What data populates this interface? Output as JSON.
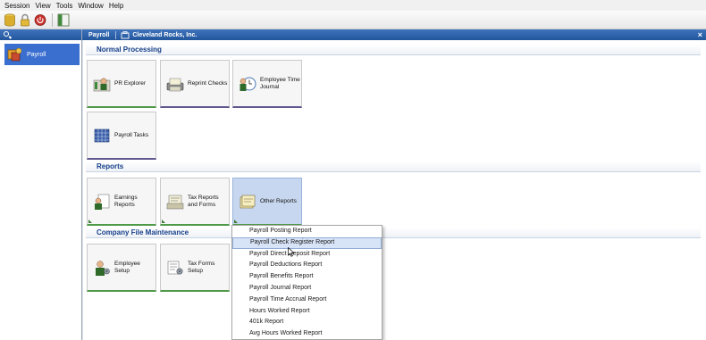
{
  "menu": [
    "Session",
    "View",
    "Tools",
    "Window",
    "Help"
  ],
  "toolbar": {
    "icons": [
      "database-icon",
      "lock-icon",
      "power-icon",
      "panel-icon"
    ]
  },
  "sidebar": {
    "items": [
      {
        "label": "Payroll",
        "icon": "payroll-icon",
        "selected": true
      }
    ]
  },
  "header": {
    "module": "Payroll",
    "company": "Cleveland Rocks, Inc."
  },
  "sections": {
    "normal": "Normal Processing",
    "reports": "Reports",
    "company_file": "Company File Maintenance"
  },
  "tiles": {
    "pr_explorer": "PR Explorer",
    "reprint_checks": "Reprint Checks",
    "employee_time_journal": "Employee Time Journal",
    "payroll_tasks": "Payroll Tasks",
    "earnings_reports": "Earnings Reports",
    "tax_reports_forms": "Tax Reports and Forms",
    "other_reports": "Other Reports",
    "employee_setup": "Employee Setup",
    "tax_forms_setup": "Tax Forms Setup"
  },
  "dropdown": {
    "items": [
      "Payroll Posting Report",
      "Payroll Check Register Report",
      "Payroll Direct Deposit Report",
      "Payroll Deductions Report",
      "Payroll Benefits Report",
      "Payroll Journal Report",
      "Payroll Time Accrual Report",
      "Hours Worked Report",
      "401k Report",
      "Avg Hours Worked Report"
    ],
    "highlighted_index": 1
  },
  "colors": {
    "header_blue": "#2a5fa8",
    "section_text": "#153f8a",
    "tile_accent_green": "#4f9a48",
    "tile_accent_purple": "#61578f",
    "selected_tile": "#c7d7ef"
  }
}
